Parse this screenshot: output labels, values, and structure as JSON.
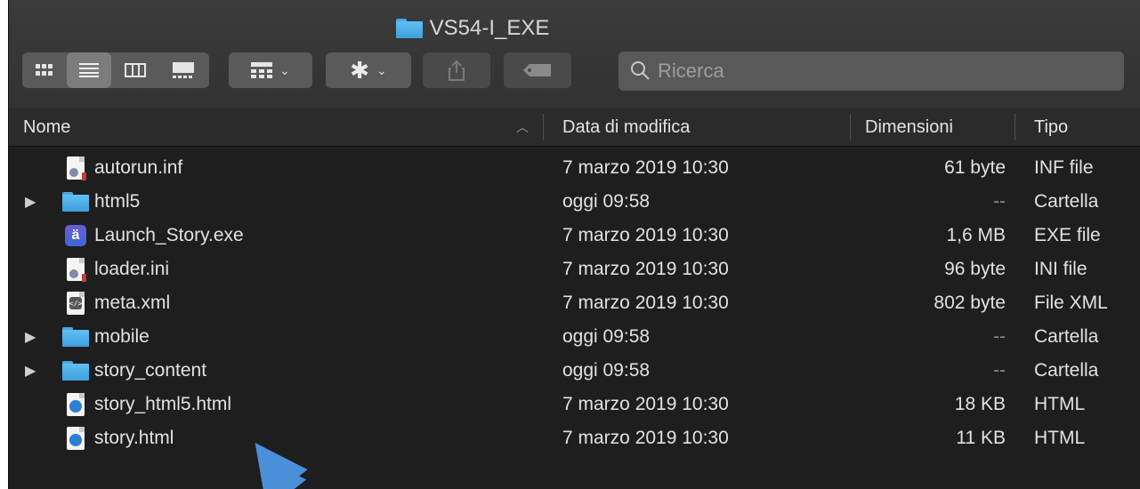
{
  "window": {
    "title": "VS54-I_EXE"
  },
  "toolbar": {
    "view_icons": [
      "icon-view-icon",
      "list-view-icon",
      "column-view-icon",
      "gallery-view-icon"
    ],
    "group_icon": "group-by-icon",
    "action_icon": "gear-icon",
    "share_icon": "share-icon",
    "tag_icon": "tag-icon"
  },
  "search": {
    "placeholder": "Ricerca"
  },
  "columns": {
    "name": "Nome",
    "date": "Data di modifica",
    "size": "Dimensioni",
    "type": "Tipo"
  },
  "files": [
    {
      "name": "autorun.inf",
      "date": "7 marzo 2019 10:30",
      "size": "61 byte",
      "type": "INF file",
      "icon": "config-file-icon",
      "folder": false
    },
    {
      "name": "html5",
      "date": "oggi 09:58",
      "size": "--",
      "type": "Cartella",
      "icon": "folder-icon",
      "folder": true
    },
    {
      "name": "Launch_Story.exe",
      "date": "7 marzo 2019 10:30",
      "size": "1,6 MB",
      "type": "EXE file",
      "icon": "app-icon",
      "folder": false
    },
    {
      "name": "loader.ini",
      "date": "7 marzo 2019 10:30",
      "size": "96 byte",
      "type": "INI file",
      "icon": "config-file-icon",
      "folder": false
    },
    {
      "name": "meta.xml",
      "date": "7 marzo 2019 10:30",
      "size": "802 byte",
      "type": "File XML",
      "icon": "xml-file-icon",
      "folder": false
    },
    {
      "name": "mobile",
      "date": "oggi 09:58",
      "size": "--",
      "type": "Cartella",
      "icon": "folder-icon",
      "folder": true
    },
    {
      "name": "story_content",
      "date": "oggi 09:58",
      "size": "--",
      "type": "Cartella",
      "icon": "folder-icon",
      "folder": true
    },
    {
      "name": "story_html5.html",
      "date": "7 marzo 2019 10:30",
      "size": "18 KB",
      "type": "HTML",
      "icon": "html-file-icon",
      "folder": false
    },
    {
      "name": "story.html",
      "date": "7 marzo 2019 10:30",
      "size": "11 KB",
      "type": "HTML",
      "icon": "html-file-icon",
      "folder": false
    }
  ],
  "annotation": {
    "icon": "pointer-arrow-icon",
    "color": "#4a90d9"
  }
}
